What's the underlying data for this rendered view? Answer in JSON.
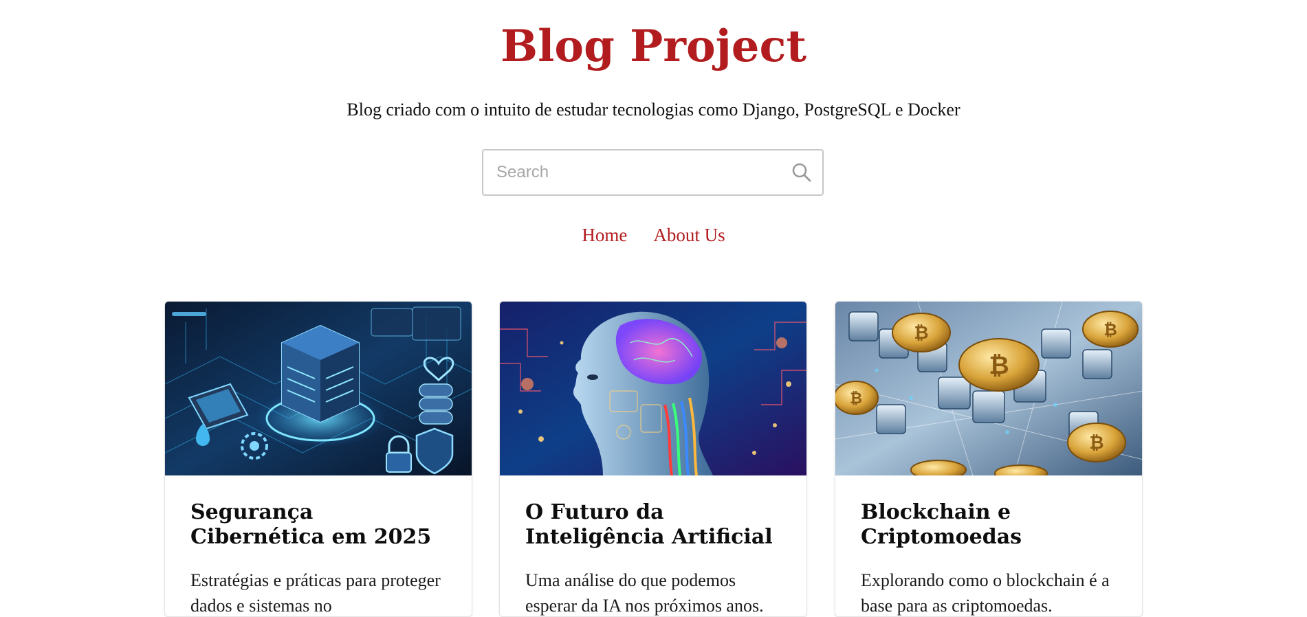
{
  "header": {
    "title": "Blog Project",
    "subtitle": "Blog criado com o intuito de estudar tecnologias como Django, PostgreSQL e Docker"
  },
  "search": {
    "placeholder": "Search",
    "value": "",
    "icon": "search-icon"
  },
  "nav": {
    "items": [
      {
        "label": "Home"
      },
      {
        "label": "About Us"
      }
    ]
  },
  "posts": [
    {
      "title": "Segurança Cibernética em 2025",
      "excerpt": "Estratégias e práticas para proteger dados e sistemas no",
      "image": "cybersecurity-illustration"
    },
    {
      "title": "O Futuro da Inteligência Artificial",
      "excerpt": "Uma análise do que podemos esperar da IA nos próximos anos.",
      "image": "ai-head-illustration"
    },
    {
      "title": "Blockchain e Criptomoedas",
      "excerpt": "Explorando como o blockchain é a base para as criptomoedas.",
      "image": "bitcoin-blockchain-illustration"
    }
  ],
  "colors": {
    "accent": "#b21c1f",
    "text": "#111111",
    "border": "#c8c8c8"
  }
}
